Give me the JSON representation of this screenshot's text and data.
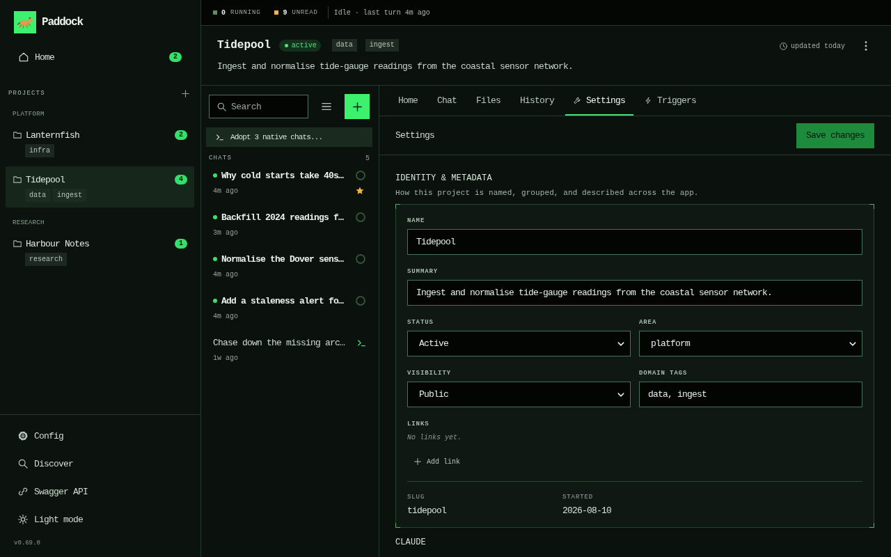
{
  "status_bar": {
    "counters": [
      {
        "count": "0",
        "label": "RUNNING",
        "color": "#5f8f69"
      },
      {
        "count": "9",
        "label": "UNREAD",
        "color": "#f2b544"
      }
    ],
    "status": "Idle · last turn 4m ago"
  },
  "sidebar": {
    "brand": "Paddock",
    "home": {
      "label": "Home",
      "badge": "2"
    },
    "projects_title": "PROJECTS",
    "groups": [
      {
        "label": "PLATFORM",
        "projects": [
          {
            "name": "Lanternfish",
            "badge": "2",
            "tags": [
              "infra"
            ],
            "selected": false
          },
          {
            "name": "Tidepool",
            "badge": "4",
            "tags": [
              "data",
              "ingest"
            ],
            "selected": true
          }
        ]
      },
      {
        "label": "RESEARCH",
        "projects": [
          {
            "name": "Harbour Notes",
            "badge": "1",
            "tags": [
              "research"
            ],
            "selected": false
          }
        ]
      }
    ],
    "footer": [
      {
        "kind": "config",
        "label": "Config"
      },
      {
        "kind": "discover",
        "label": "Discover"
      },
      {
        "kind": "api",
        "label": "Swagger API"
      },
      {
        "kind": "theme",
        "label": "Light mode"
      }
    ],
    "version": "v0.69.0"
  },
  "project": {
    "title": "Tidepool",
    "status": "active",
    "tags": [
      "data",
      "ingest"
    ],
    "summary": "Ingest and normalise tide-gauge readings from the coastal sensor network.",
    "updated": "updated today"
  },
  "chats_panel": {
    "search": {
      "placeholder": "Search"
    },
    "banner": "Adopt 3 native chats...",
    "title": "CHATS",
    "count": "5",
    "chats": [
      {
        "title": "Why cold starts take 40s…",
        "time": "4m ago",
        "unread": true,
        "starred": true,
        "kind": "session"
      },
      {
        "title": "Backfill 2024 readings f…",
        "time": "3m ago",
        "unread": true,
        "starred": false,
        "kind": "session"
      },
      {
        "title": "Normalise the Dover sens…",
        "time": "4m ago",
        "unread": true,
        "starred": false,
        "kind": "session"
      },
      {
        "title": "Add a staleness alert fo…",
        "time": "4m ago",
        "unread": true,
        "starred": false,
        "kind": "session"
      },
      {
        "title": "Chase down the missing arc…",
        "time": "1w ago",
        "unread": false,
        "starred": false,
        "kind": "native"
      }
    ]
  },
  "tabs": [
    {
      "label": "Home",
      "kind": "plain",
      "selected": false
    },
    {
      "label": "Chat",
      "kind": "plain",
      "selected": false
    },
    {
      "label": "Files",
      "kind": "plain",
      "selected": false
    },
    {
      "label": "History",
      "kind": "plain",
      "selected": false
    },
    {
      "label": "Settings",
      "kind": "settings",
      "selected": true
    },
    {
      "label": "Triggers",
      "kind": "triggers",
      "selected": false
    }
  ],
  "settings": {
    "title": "Settings",
    "save": "Save changes",
    "sections": [
      {
        "title": "IDENTITY & METADATA",
        "description": "How this project is named, grouped, and described across the app.",
        "rows": [
          [
            {
              "kind": "text",
              "label": "NAME",
              "value": "Tidepool"
            }
          ],
          [
            {
              "kind": "text",
              "label": "SUMMARY",
              "value": "Ingest and normalise tide-gauge readings from the coastal sensor network."
            }
          ],
          [
            {
              "kind": "select",
              "label": "STATUS",
              "value": "Active"
            },
            {
              "kind": "select",
              "label": "AREA",
              "value": "platform"
            }
          ],
          [
            {
              "kind": "select",
              "label": "VISIBILITY",
              "value": "Public"
            },
            {
              "kind": "text",
              "label": "DOMAIN TAGS",
              "value": "data, ingest"
            }
          ]
        ],
        "links": {
          "label": "LINKS",
          "empty": "No links yet.",
          "add": "Add link"
        },
        "meta": [
          {
            "label": "SLUG",
            "value": "tidepool"
          },
          {
            "label": "STARTED",
            "value": "2026-08-10"
          }
        ]
      },
      {
        "title": "CLAUDE"
      }
    ]
  }
}
